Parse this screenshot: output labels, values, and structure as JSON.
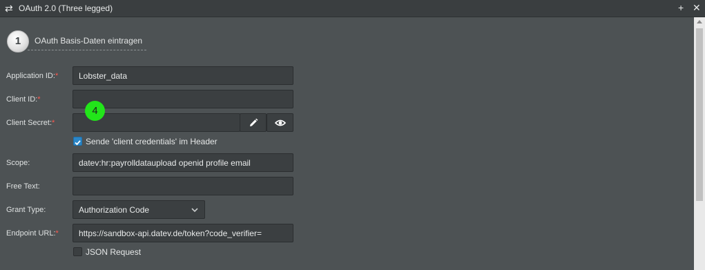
{
  "window": {
    "title": "OAuth 2.0 (Three legged)",
    "icon": "swap-arrows-icon"
  },
  "step": {
    "number": "1",
    "title": "OAuth Basis-Daten eintragen"
  },
  "annotation": {
    "number": "4",
    "color": "#22e51a"
  },
  "fields": {
    "application_id": {
      "label": "Application ID:",
      "required": "*",
      "value": "Lobster_data"
    },
    "client_id": {
      "label": "Client ID:",
      "required": "*",
      "value": ""
    },
    "client_secret": {
      "label": "Client Secret:",
      "required": "*",
      "value": ""
    },
    "send_credentials": {
      "label": "Sende 'client credentials' im Header",
      "checked": true
    },
    "scope": {
      "label": "Scope:",
      "value": "datev:hr:payrolldataupload openid profile email"
    },
    "free_text": {
      "label": "Free Text:",
      "value": ""
    },
    "grant_type": {
      "label": "Grant Type:",
      "value": "Authorization Code"
    },
    "endpoint_url": {
      "label": "Endpoint URL:",
      "required": "*",
      "value": "https://sandbox-api.datev.de/token?code_verifier="
    },
    "json_request": {
      "label": "JSON Request",
      "checked": false
    }
  },
  "colors": {
    "accent": "#2a86c8",
    "required": "#ff5a4f",
    "background": "#4d5254"
  }
}
